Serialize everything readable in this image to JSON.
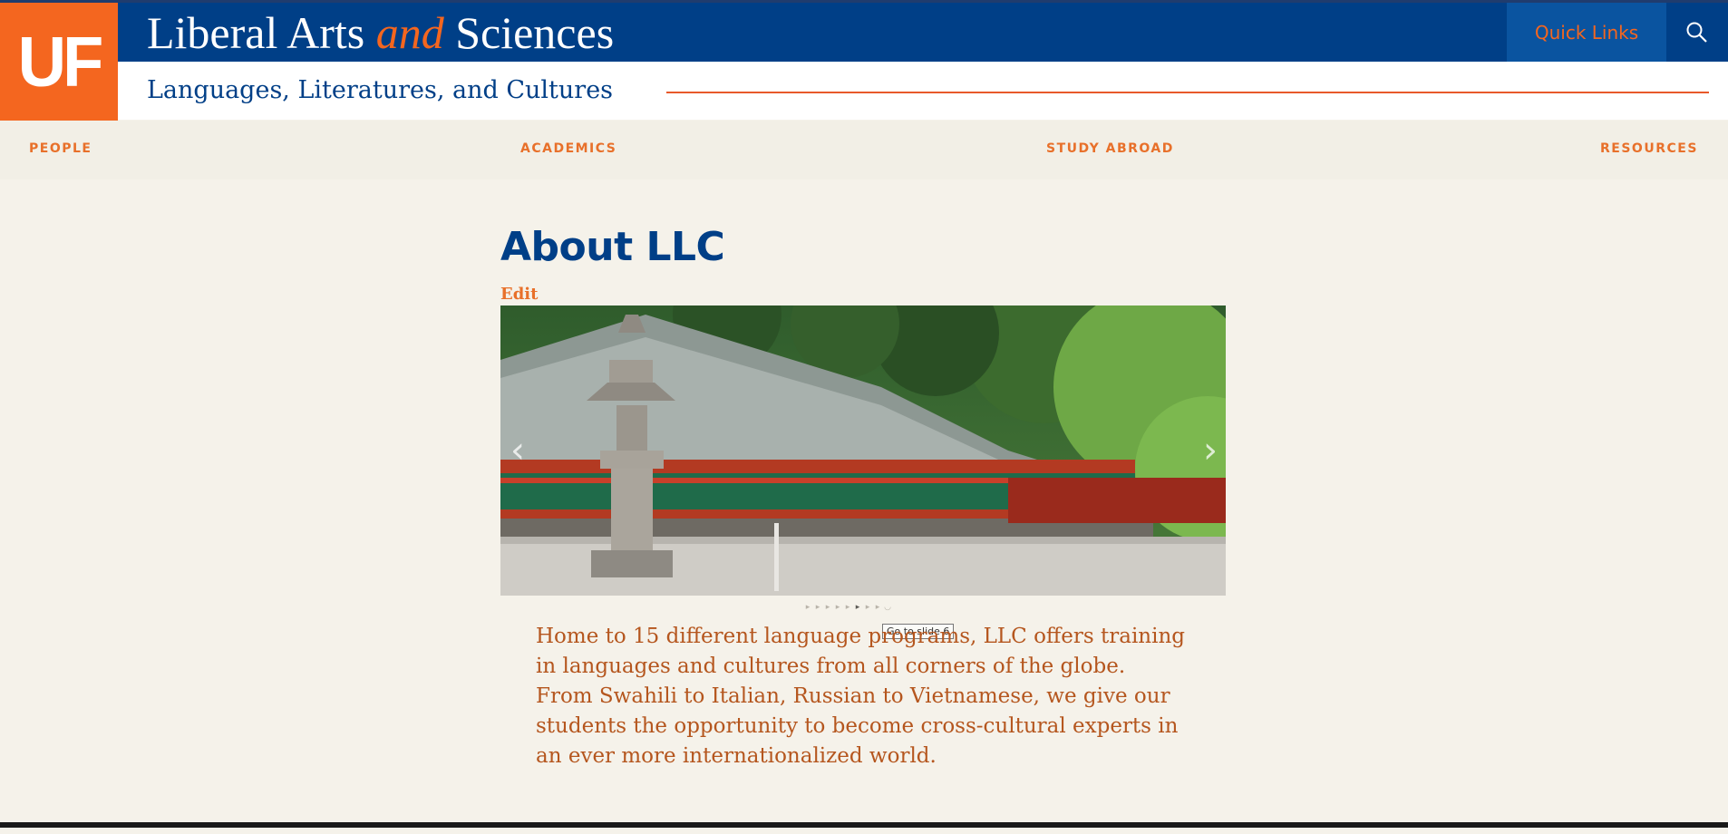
{
  "logo": {
    "text": "UF"
  },
  "header": {
    "college_part1": "Liberal Arts ",
    "college_and": "and",
    "college_part2": " Sciences",
    "department": "Languages, Literatures, and Cultures",
    "quick_links": "Quick Links",
    "search_icon": "search-icon"
  },
  "nav": {
    "items": [
      "PEOPLE",
      "ACADEMICS",
      "STUDY ABROAD",
      "RESOURCES"
    ]
  },
  "main": {
    "title": "About LLC",
    "edit": "Edit",
    "slider": {
      "prev": "‹",
      "next": "›",
      "dots_count": 9,
      "active_dot": 6,
      "tooltip": "Go to slide 6"
    },
    "intro": "Home to 15 different language programs, LLC offers training in languages and cultures from all corners of the globe. From Swahili to Italian, Russian to Vietnamese, we give our students the opportunity to become cross-cultural experts in an ever more internationalized world."
  },
  "colors": {
    "uf_orange": "#f4661f",
    "uf_blue": "#003f87",
    "background": "#f5f2ea",
    "intro_text": "#b5561e"
  }
}
